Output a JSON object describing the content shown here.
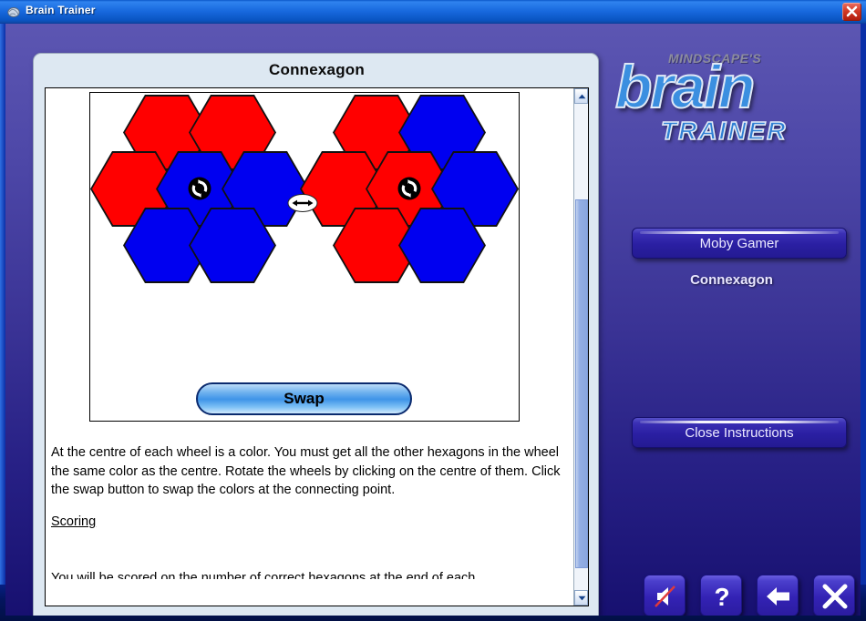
{
  "window": {
    "title": "Brain Trainer",
    "icon": "brain-icon",
    "close_icon": "close-icon"
  },
  "instructions": {
    "title": "Connexagon",
    "swap_button_label": "Swap",
    "paragraphs": [
      "At the centre of each wheel is a color.  You must get all the other hexagons in the wheel the same color as the centre.  Rotate the wheels by clicking on the centre of them.  Click the swap button to swap the colors at the connecting point."
    ],
    "scoring_heading": "Scoring",
    "scoring_text_clipped": "You will be scored on the number of correct hexagons at the end of each",
    "scrollbar": {
      "up_arrow_icon": "chevron-up-icon",
      "down_arrow_icon": "chevron-down-icon"
    }
  },
  "puzzle": {
    "colors": {
      "red": "#ff0000",
      "blue": "#0000f0",
      "outline": "#111111"
    },
    "rotate_icon": "rotate-icon",
    "swap_icon": "swap-arrows-icon",
    "wheels": [
      {
        "name": "left-wheel",
        "centre_color": "blue",
        "cells": [
          {
            "position": "top-left",
            "color": "red"
          },
          {
            "position": "top-right",
            "color": "red"
          },
          {
            "position": "left",
            "color": "red"
          },
          {
            "position": "centre",
            "color": "blue"
          },
          {
            "position": "right",
            "color": "blue"
          },
          {
            "position": "bottom-left",
            "color": "blue"
          },
          {
            "position": "bottom-right",
            "color": "blue"
          }
        ]
      },
      {
        "name": "right-wheel",
        "centre_color": "red",
        "cells": [
          {
            "position": "top-left",
            "color": "red"
          },
          {
            "position": "top-right",
            "color": "blue"
          },
          {
            "position": "left",
            "color": "red"
          },
          {
            "position": "centre",
            "color": "red"
          },
          {
            "position": "right",
            "color": "blue"
          },
          {
            "position": "bottom-left",
            "color": "red"
          },
          {
            "position": "bottom-right",
            "color": "blue"
          }
        ]
      }
    ]
  },
  "right_panel": {
    "logo": {
      "publisher": "MINDSCAPE'S",
      "brand": "brain",
      "subbrand": "TRAINER"
    },
    "moby_gamer_label": "Moby Gamer",
    "current_puzzle": "Connexagon",
    "close_instructions_label": "Close Instructions",
    "icon_buttons": [
      {
        "name": "mute-button",
        "icon": "speaker-muted-icon"
      },
      {
        "name": "help-button",
        "icon": "question-mark-icon"
      },
      {
        "name": "back-button",
        "icon": "left-arrow-icon"
      },
      {
        "name": "exit-button",
        "icon": "close-x-icon"
      }
    ]
  },
  "theme": {
    "window_accent": "#0a55c2",
    "panel_background": "#dde8f2",
    "panel_gradient_top": "#5c56b2",
    "panel_gradient_bottom": "#171070",
    "button_purple": "#2a1fa2"
  }
}
